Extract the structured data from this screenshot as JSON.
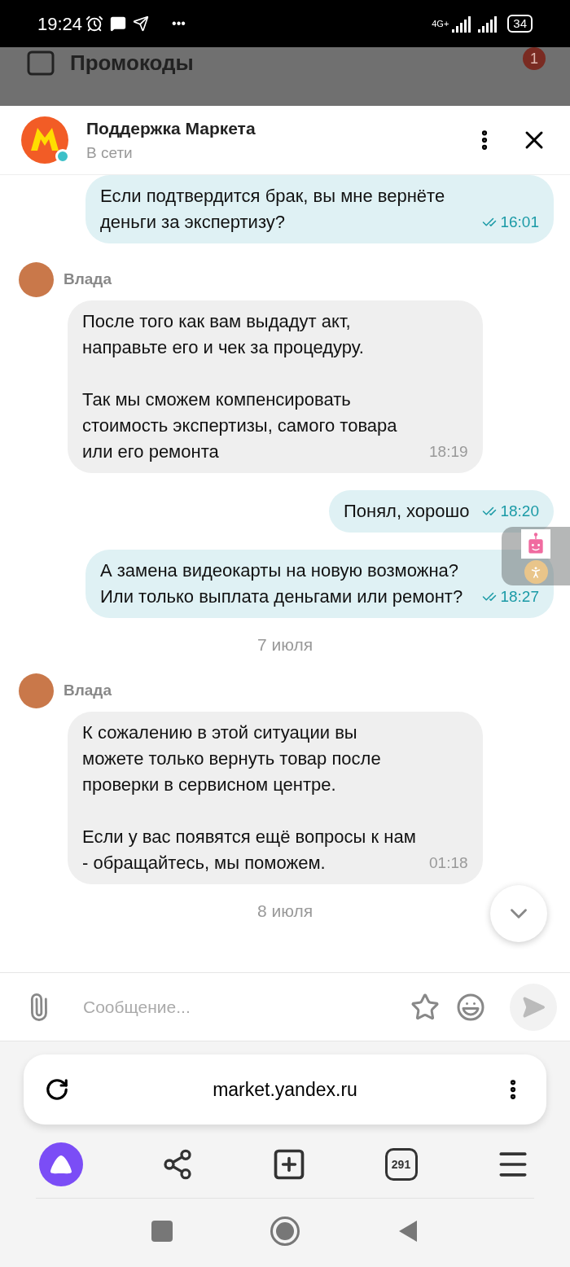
{
  "status_bar": {
    "time": "19:24",
    "more": "•••",
    "battery": "34",
    "network": "4G+"
  },
  "background_page": {
    "title": "Промокоды",
    "badge": "1"
  },
  "chat_header": {
    "title": "Поддержка Маркета",
    "status": "В сети",
    "online": true
  },
  "messages": [
    {
      "kind": "outgoing",
      "paragraphs": [
        "Если подтвердится брак, вы мне вернёте деньги за экспертизу?"
      ],
      "time": "16:01",
      "read": true
    },
    {
      "kind": "sender",
      "name": "Влада"
    },
    {
      "kind": "incoming",
      "paragraphs": [
        "После того как вам выдадут акт, направьте его и чек за процедуру.",
        "Так мы сможем компенсировать стоимость экспертизы, самого товара или его ремонта"
      ],
      "time": "18:19"
    },
    {
      "kind": "outgoing",
      "paragraphs": [
        "Понял, хорошо"
      ],
      "time": "18:20",
      "read": true
    },
    {
      "kind": "outgoing",
      "paragraphs": [
        "А замена видеокарты на новую возможна? Или только выплата деньгами или ремонт?"
      ],
      "time": "18:27",
      "read": true
    },
    {
      "kind": "date",
      "text": "7 июля"
    },
    {
      "kind": "sender",
      "name": "Влада"
    },
    {
      "kind": "incoming",
      "paragraphs": [
        "К сожалению в этой ситуации вы можете только вернуть товар после проверки в сервисном центре.",
        "Если у вас появятся ещё вопросы к нам - обращайтесь, мы поможем."
      ],
      "time": "01:18"
    },
    {
      "kind": "date",
      "text": "8 июля"
    }
  ],
  "composer": {
    "placeholder": "Сообщение..."
  },
  "browser": {
    "url": "market.yandex.ru",
    "tabs_count": "291"
  }
}
